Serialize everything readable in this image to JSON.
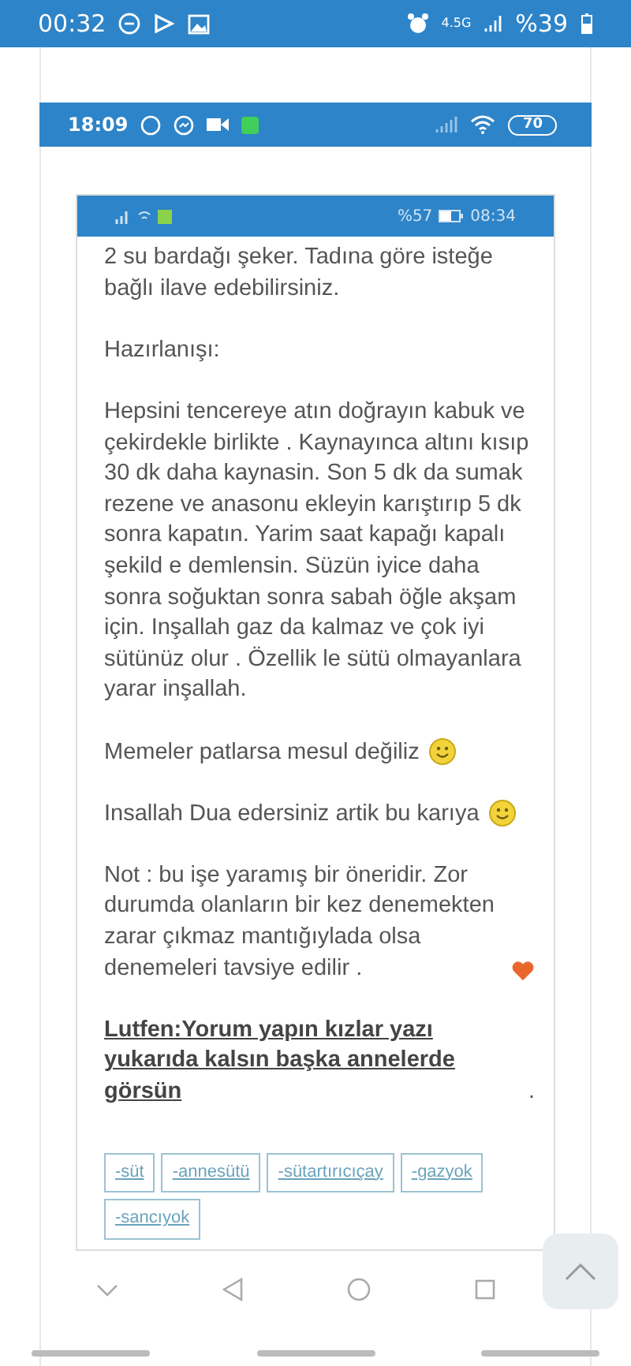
{
  "status_bar": {
    "time": "00:32",
    "network": "4.5G",
    "battery": "%39"
  },
  "inner_status_bar": {
    "time": "18:09",
    "battery": "70"
  },
  "article": {
    "status_bar": {
      "battery": "%57",
      "time": "08:34"
    },
    "paragraphs": [
      {
        "kind": "plain",
        "text": "2 su bardağı şeker.  Tadına göre isteğe bağlı ilave edebilirsiniz."
      },
      {
        "kind": "plain",
        "text": "Hazırlanışı:"
      },
      {
        "kind": "plain",
        "text": "Hepsini tencereye atın doğrayın kabuk ve çekirdekle birlikte . Kaynayınca altını kısıp 30 dk daha kaynasin. Son 5 dk da sumak rezene ve anasonu ekleyin karıştırıp 5 dk sonra kapatın.  Yarim saat kapağı kapalı şekild e demlensin.  Süzün iyice daha sonra soğuktan sonra sabah öğle akşam için. Inşallah gaz da kalmaz ve çok iyi sütünüz olur . Özellik le sütü olmayanlara yarar inşallah."
      },
      {
        "kind": "smiley",
        "text": "Memeler patlarsa mesul değiliz"
      },
      {
        "kind": "smiley",
        "text": "Insallah Dua edersiniz artik bu karıya"
      },
      {
        "kind": "heart",
        "text": "Not : bu işe yaramış bir öneridir.  Zor durumda olanların bir kez denemekten zarar çıkmaz mantığıylada olsa denemeleri tavsiye edilir ."
      },
      {
        "kind": "link",
        "text": "Lutfen:Yorum yapın kızlar yazı yukarıda kalsın başka annelerde görsün",
        "after": "."
      }
    ],
    "tags": [
      "-süt",
      "-annesütü",
      "-sütartırıcıçay",
      "-gazyok",
      "-sancıyok"
    ]
  }
}
